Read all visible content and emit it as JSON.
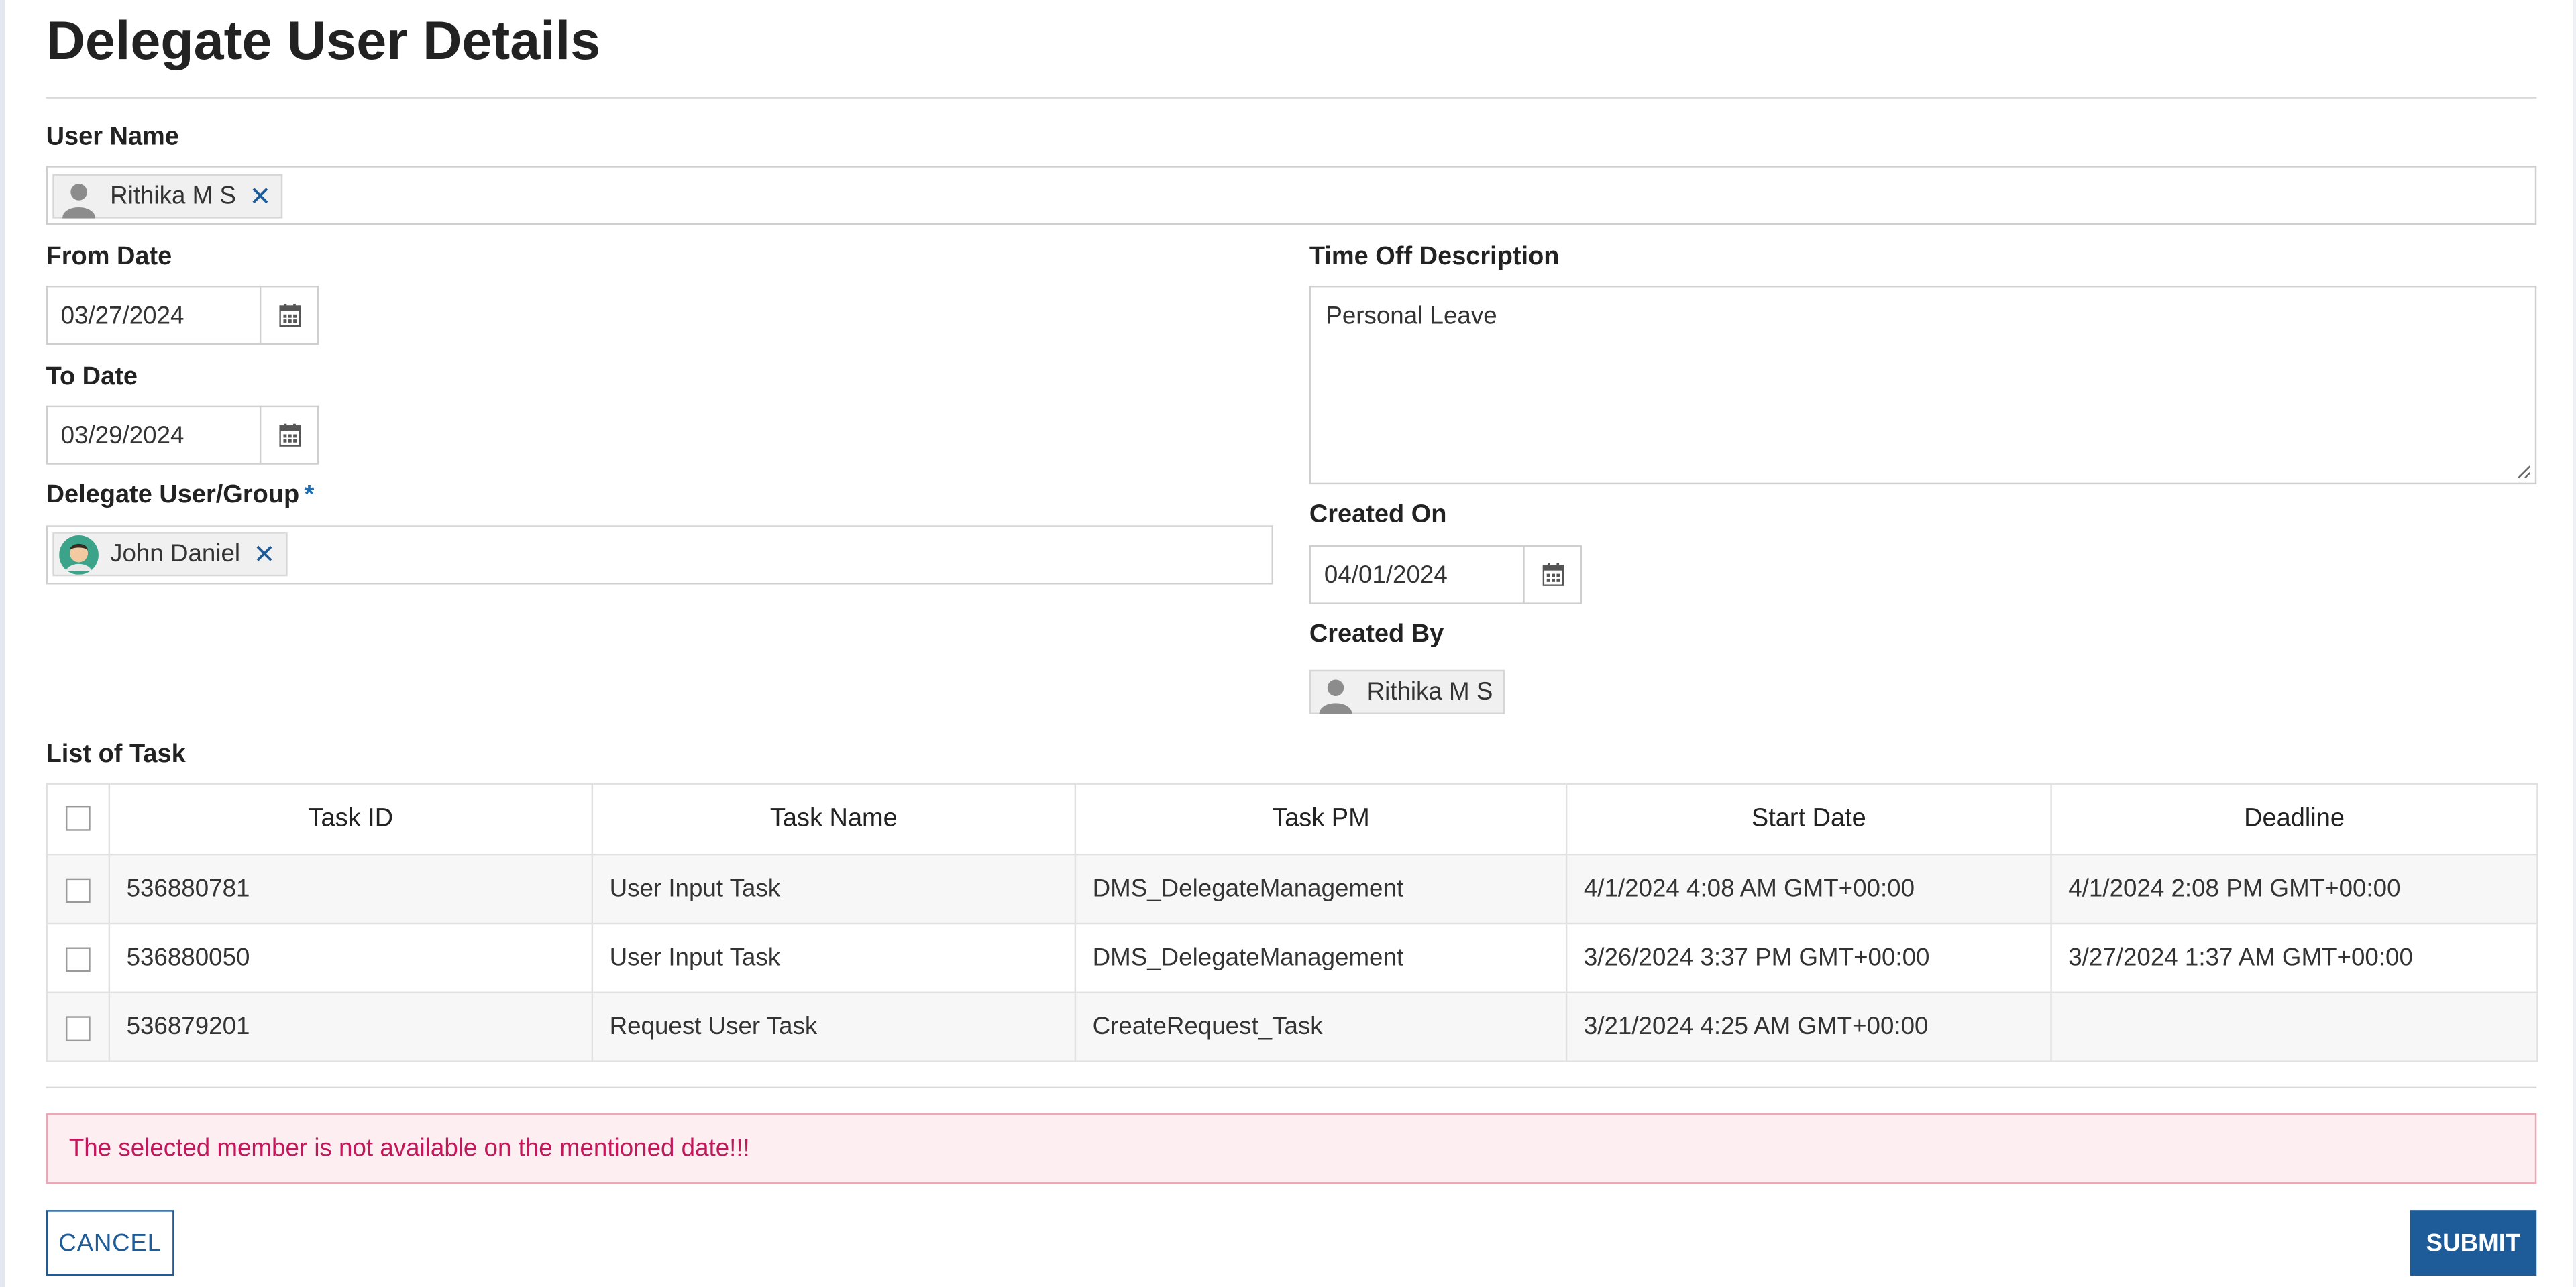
{
  "page": {
    "title": "Delegate User Details"
  },
  "user_name": {
    "label": "User Name",
    "chip": {
      "name": "Rithika M S",
      "remove": "✕"
    }
  },
  "from_date": {
    "label": "From Date",
    "value": "03/27/2024"
  },
  "to_date": {
    "label": "To Date",
    "value": "03/29/2024"
  },
  "delegate": {
    "label": "Delegate User/Group",
    "required_mark": "*",
    "chip": {
      "name": "John Daniel",
      "remove": "✕"
    }
  },
  "time_off": {
    "label": "Time Off Description",
    "value": "Personal Leave"
  },
  "created_on": {
    "label": "Created On",
    "value": "04/01/2024"
  },
  "created_by": {
    "label": "Created By",
    "name": "Rithika M S"
  },
  "tasks": {
    "label": "List of Task",
    "columns": [
      "Task ID",
      "Task Name",
      "Task PM",
      "Start Date",
      "Deadline"
    ],
    "rows": [
      [
        "536880781",
        "User Input Task",
        "DMS_DelegateManagement",
        "4/1/2024 4:08 AM GMT+00:00",
        "4/1/2024 2:08 PM GMT+00:00"
      ],
      [
        "536880050",
        "User Input Task",
        "DMS_DelegateManagement",
        "3/26/2024 3:37 PM GMT+00:00",
        "3/27/2024 1:37 AM GMT+00:00"
      ],
      [
        "536879201",
        "Request User Task",
        "CreateRequest_Task",
        "3/21/2024 4:25 AM GMT+00:00",
        ""
      ]
    ]
  },
  "alert": {
    "message": "The selected member is not available on the mentioned date!!!"
  },
  "actions": {
    "cancel": "CANCEL",
    "submit": "SUBMIT"
  },
  "colors": {
    "accent": "#1e5c99",
    "alert_text": "#c2185b",
    "alert_bg": "#fdeef1"
  },
  "icons": {
    "calendar": "calendar-icon",
    "user_avatar": "user-silhouette-icon",
    "delegate_avatar": "person-avatar-icon",
    "remove": "close-icon"
  }
}
